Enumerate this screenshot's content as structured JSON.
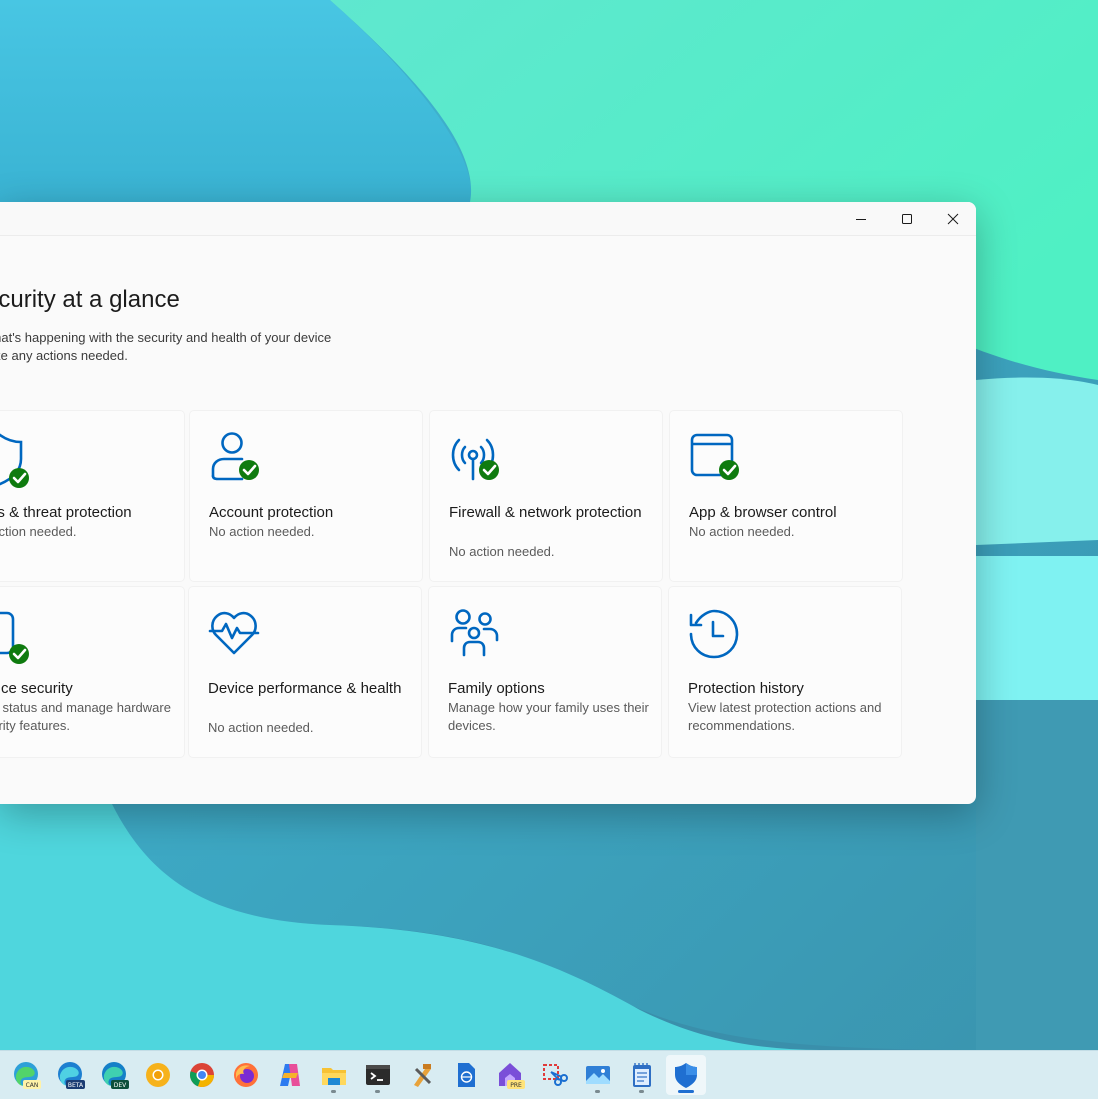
{
  "window": {
    "title": "Security at a glance",
    "description_line1": "See what's happening with the security and health of your device",
    "description_line2": "and take any actions needed."
  },
  "captions": {
    "minimize_icon": "minimize-icon",
    "maximize_icon": "maximize-icon",
    "close_icon": "close-icon"
  },
  "tiles": [
    {
      "title": "Virus & threat protection",
      "subtitle": "No action needed.",
      "icon": "shield-check-icon",
      "status": "ok"
    },
    {
      "title": "Account protection",
      "subtitle": "No action needed.",
      "icon": "person-check-icon",
      "status": "ok"
    },
    {
      "title": "Firewall & network protection",
      "subtitle": "No action needed.",
      "icon": "antenna-check-icon",
      "status": "ok"
    },
    {
      "title": "App & browser control",
      "subtitle": "No action needed.",
      "icon": "app-window-check-icon",
      "status": "ok"
    },
    {
      "title": "Device security",
      "subtitle": "View status and manage hardware security features.",
      "icon": "device-check-icon",
      "status": "ok"
    },
    {
      "title": "Device performance & health",
      "subtitle": "No action needed.",
      "icon": "heart-pulse-icon"
    },
    {
      "title": "Family options",
      "subtitle": "Manage how your family uses their devices.",
      "icon": "family-icon"
    },
    {
      "title": "Protection history",
      "subtitle": "View latest protection actions and recommendations.",
      "icon": "history-clock-icon"
    }
  ],
  "taskbar": {
    "apps": [
      {
        "name": "edge-canary-icon",
        "badge": "CAN"
      },
      {
        "name": "edge-beta-icon",
        "badge": "BETA"
      },
      {
        "name": "edge-dev-icon",
        "badge": "DEV"
      },
      {
        "name": "chrome-canary-icon"
      },
      {
        "name": "chrome-icon"
      },
      {
        "name": "firefox-icon"
      },
      {
        "name": "copilot-icon"
      },
      {
        "name": "file-explorer-icon"
      },
      {
        "name": "terminal-icon"
      },
      {
        "name": "tools-icon"
      },
      {
        "name": "document-globe-icon"
      },
      {
        "name": "dev-home-preview-icon",
        "badge": "PRE"
      },
      {
        "name": "snipping-tool-icon"
      },
      {
        "name": "photos-icon"
      },
      {
        "name": "notepad-icon"
      },
      {
        "name": "windows-security-icon"
      }
    ]
  },
  "colors": {
    "accent": "#0067c0",
    "ok_green": "#0f7b0f",
    "title_text": "#1b1b1b",
    "subtitle_text": "#5a5a5a"
  }
}
